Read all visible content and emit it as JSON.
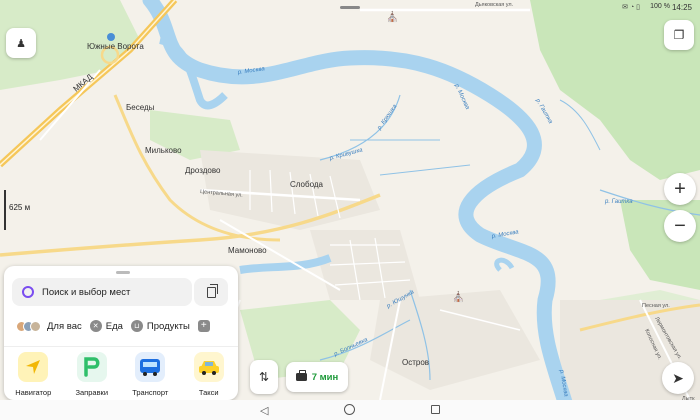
{
  "status_bar": {
    "battery": "100 %",
    "time": "14:25"
  },
  "map": {
    "scale_label": "625 м",
    "places": {
      "yuzhnye_vorota": "Южные Ворота",
      "mkad": "МКАД",
      "besedy": "Беседы",
      "milkovo": "Мильково",
      "drozdovo": "Дроздово",
      "sloboda": "Слобода",
      "mamonovo": "Мамоново",
      "ostrov": "Остров"
    },
    "rivers": {
      "moskva": "р. Москва",
      "kryshushka": "р. Кривушка",
      "kryshushka2": "р. Крюшка",
      "yushunka": "р. Юшунка",
      "gaitka": "р. Гаитка",
      "bolnovka": "р. Болньевка"
    },
    "roads": {
      "tsentralnaya": "Центральная ул.",
      "dyakovskaya": "Дьяковская ул.",
      "pesnaya": "Песная ул.",
      "lermontova": "Лермонтовская ул.",
      "koposnaya": "Копосная ул.",
      "lytk": "Лытк"
    },
    "colors": {
      "water": "#a9d3ef",
      "park": "#c9e6b9",
      "land": "#f4f1ea",
      "road_major": "#f7d98a",
      "road_minor": "#ffffff",
      "mkad": "#f5c75a"
    }
  },
  "controls": {
    "zoom_in": "+",
    "zoom_out": "−"
  },
  "panel": {
    "search_placeholder": "Поиск и выбор мест",
    "chips": [
      {
        "label": "Для вас",
        "icon": "avatars-icon"
      },
      {
        "label": "Еда",
        "icon": "fork-knife-icon"
      },
      {
        "label": "Продукты",
        "icon": "basket-icon"
      }
    ],
    "services": [
      {
        "label": "Навигатор",
        "icon": "navigator-arrow-icon",
        "color": "#f7d64a"
      },
      {
        "label": "Заправки",
        "icon": "fuel-p-icon",
        "color": "#2fbf6a"
      },
      {
        "label": "Транспорт",
        "icon": "bus-icon",
        "color": "#1d6fe0"
      },
      {
        "label": "Такси",
        "icon": "taxi-icon",
        "color": "#fcd12a"
      }
    ]
  },
  "route": {
    "eta": "7 мин"
  }
}
